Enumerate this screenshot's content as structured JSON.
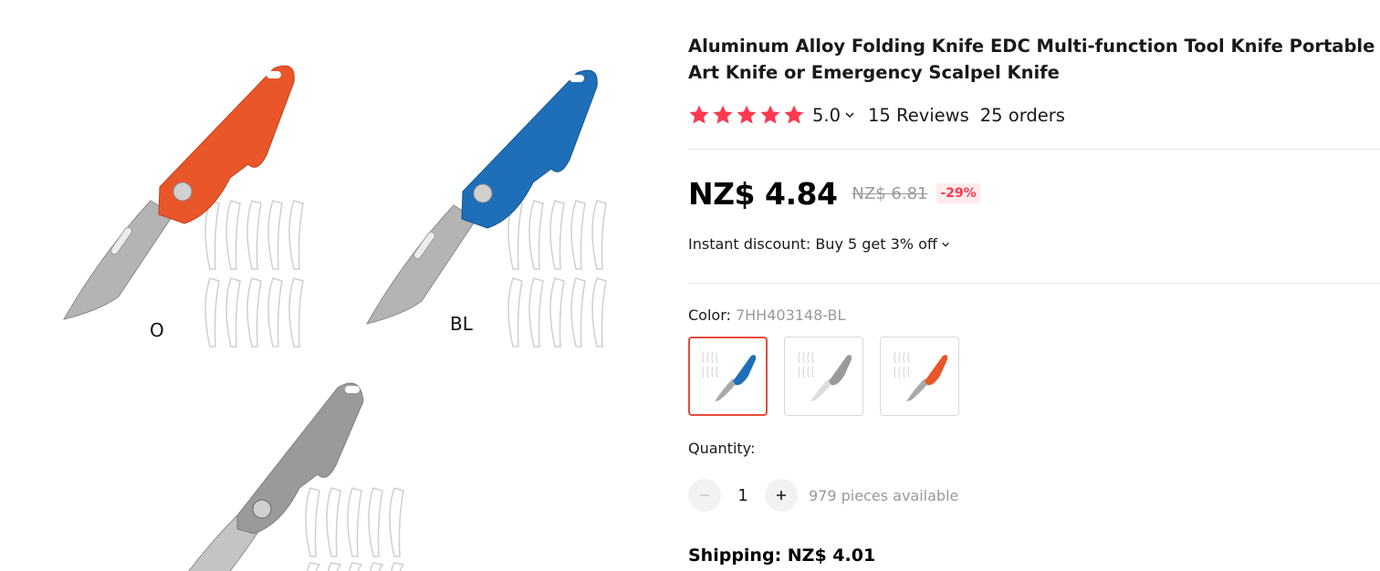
{
  "gallery": {
    "images": [
      {
        "label": "O",
        "handle_color": "#e8562a",
        "handle_shade": "#c2401a"
      },
      {
        "label": "BL",
        "handle_color": "#1f6fb8",
        "handle_shade": "#145391"
      },
      {
        "label": "",
        "handle_color": "#9a9a9a",
        "handle_shade": "#7d7d7d"
      }
    ]
  },
  "product": {
    "title": "Aluminum Alloy Folding Knife EDC Multi-function Tool Knife Portable Art Knife or Emergency Scalpel Knife",
    "rating": {
      "stars": 5,
      "value": "5.0",
      "reviews": "15 Reviews",
      "orders": "25 orders",
      "star_color": "#fd384f"
    },
    "price": {
      "current": "NZ$ 4.84",
      "original": "NZ$ 6.81",
      "discount": "-29%"
    },
    "instant_discount": "Instant discount: Buy 5 get 3% off",
    "color": {
      "label": "Color: ",
      "selected_value": "7HH403148-BL",
      "options": [
        {
          "name": "blue",
          "selected": true,
          "handle_color": "#1f6fb8"
        },
        {
          "name": "gray",
          "selected": false,
          "handle_color": "#9a9a9a"
        },
        {
          "name": "orange",
          "selected": false,
          "handle_color": "#e8562a"
        }
      ]
    },
    "quantity": {
      "label": "Quantity:",
      "value": "1",
      "available": "979 pieces available"
    },
    "shipping": "Shipping: NZ$ 4.01"
  }
}
